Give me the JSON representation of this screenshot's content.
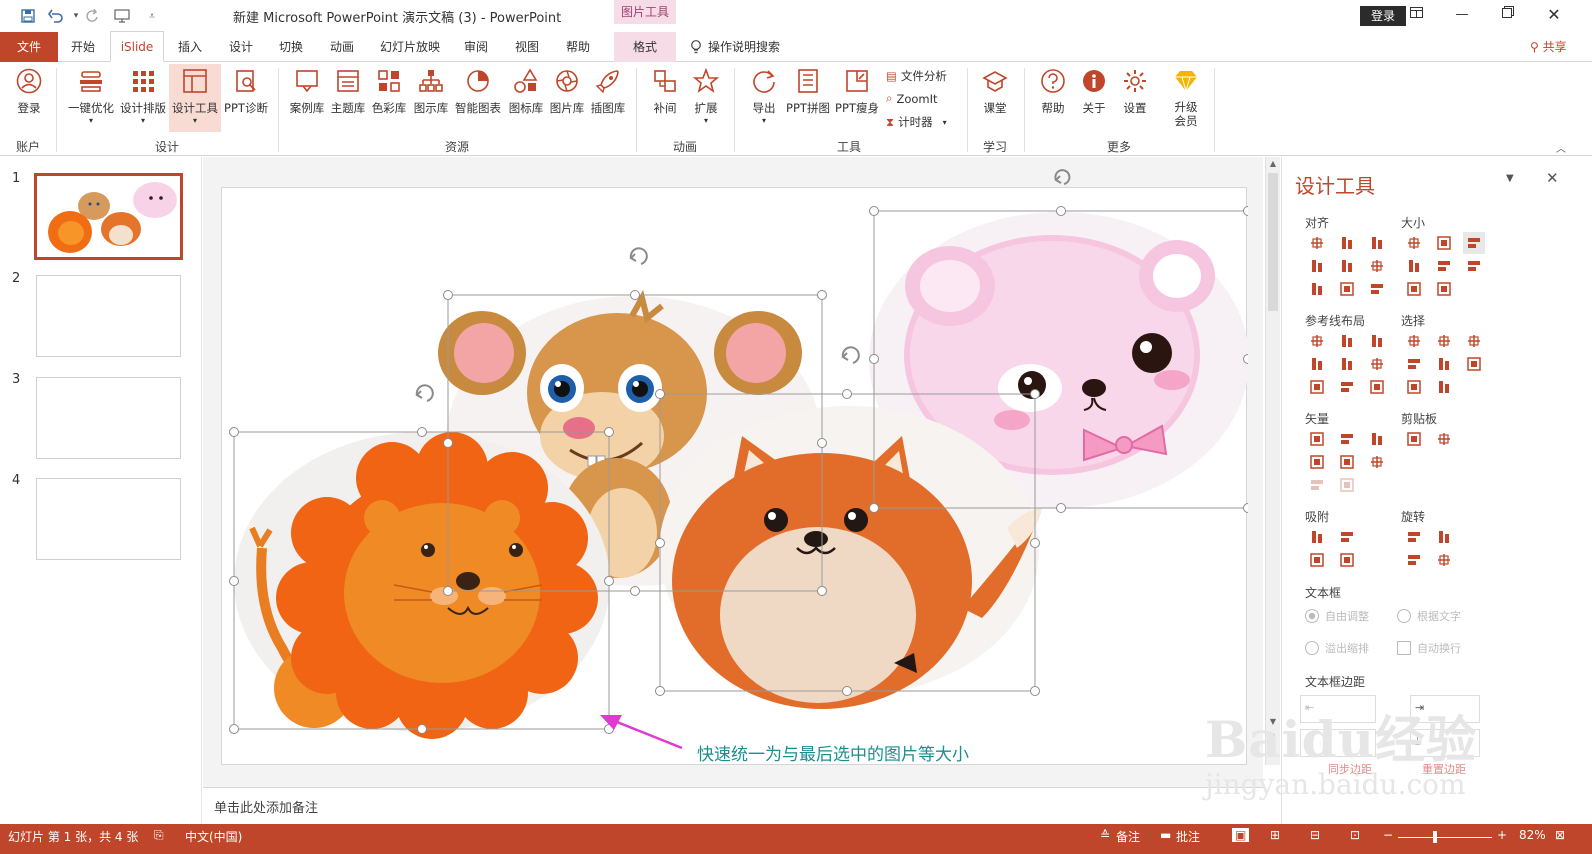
{
  "title_bar": {
    "doc_title": "新建 Microsoft PowerPoint 演示文稿 (3)  -  PowerPoint",
    "context_label": "图片工具",
    "login_label": "登录",
    "window_buttons": [
      "restore-ribbon-icon",
      "minimize-icon",
      "restore-icon",
      "close-icon"
    ]
  },
  "tabs": {
    "file": "文件",
    "items": [
      "开始",
      "iSlide",
      "插入",
      "设计",
      "切换",
      "动画",
      "幻灯片放映",
      "审阅",
      "视图",
      "帮助",
      "格式"
    ],
    "active": "iSlide",
    "search_label": "操作说明搜索",
    "share_label": "共享"
  },
  "ribbon": {
    "buttons": {
      "login": "登录",
      "optimize": "一键优化",
      "layout": "设计排版",
      "design_tools": "设计工具",
      "diagnose": "PPT诊断",
      "cases": "案例库",
      "themes": "主题库",
      "colors": "色彩库",
      "diagrams": "图示库",
      "charts": "智能图表",
      "icons": "图标库",
      "images": "图片库",
      "illustrations": "插图库",
      "tween": "补间",
      "extend": "扩展",
      "export": "导出",
      "ppt_stitch": "PPT拼图",
      "ppt_slim": "PPT瘦身",
      "course": "课堂",
      "help": "帮助",
      "about": "关于",
      "settings": "设置",
      "upgrade": "升级\n会员"
    },
    "small_buttons": {
      "file_analysis": "文件分析",
      "zoomit": "ZoomIt",
      "timer": "计时器"
    },
    "groups": {
      "account": "账户",
      "design": "设计",
      "resources": "资源",
      "animation": "动画",
      "tools": "工具",
      "learn": "学习",
      "more": "更多"
    }
  },
  "thumbnails": {
    "numbers": [
      "1",
      "2",
      "3",
      "4"
    ],
    "selected": 1
  },
  "slide": {
    "annotation": "快速统一为与最后选中的图片等大小"
  },
  "notes_placeholder": "单击此处添加备注",
  "panel": {
    "title": "设计工具",
    "sections": {
      "align": "对齐",
      "size": "大小",
      "guides": "参考线布局",
      "select": "选择",
      "vector": "矢量",
      "clipboard": "剪贴板",
      "snap": "吸附",
      "rotate": "旋转",
      "textbox": "文本框",
      "text_margin": "文本框边距"
    },
    "textbox_options": {
      "auto_adjust": "自由调整",
      "fit_text": "根据文字",
      "overflow_shrink": "溢出缩排",
      "auto_wrap": "自动换行"
    },
    "margin_labels": {
      "sync_left": "同步边距",
      "sync_right": "重置边距"
    }
  },
  "status_bar": {
    "slide_info": "幻灯片 第 1 张，共 4 张",
    "language": "中文(中国)",
    "notes": "备注",
    "comments": "批注",
    "zoom": "82%"
  },
  "watermark": {
    "logo": "Baidu经验",
    "url": "jingyan.baidu.com"
  },
  "colors": {
    "accent": "#c0462b",
    "context_tab": "#f6dce6",
    "panel_icon": "#c0462b",
    "annotation_text": "#1a8f8f",
    "arrow": "#e23ad0"
  }
}
